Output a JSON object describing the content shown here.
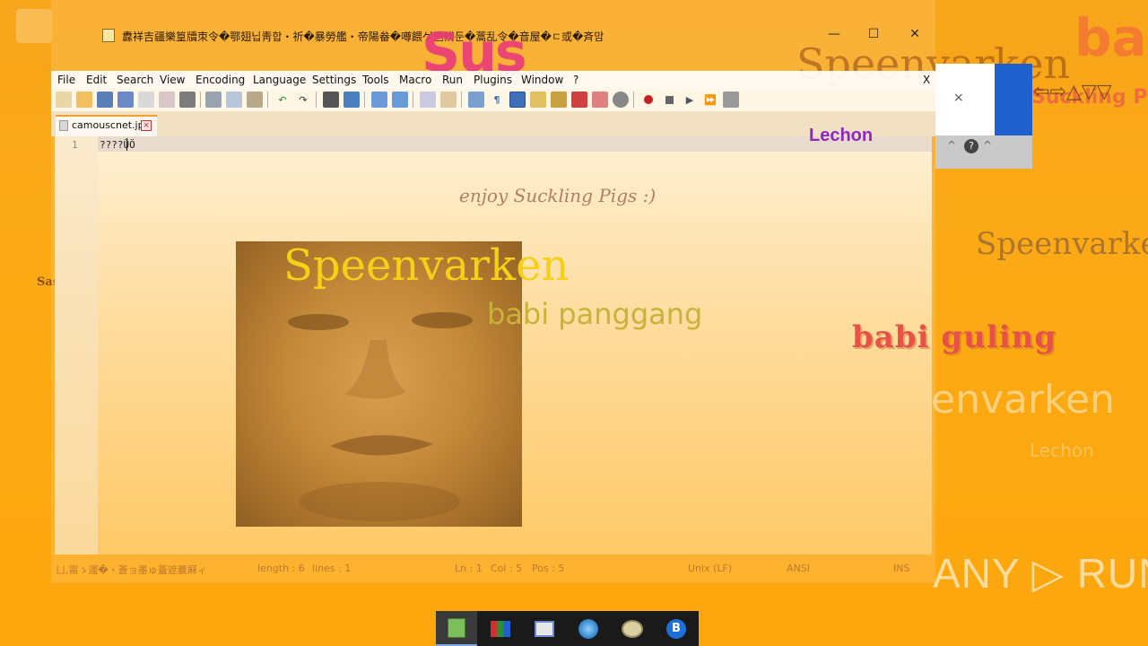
{
  "desktop": {
    "sas_text": "Sas",
    "sus_text": "Sus",
    "speenvarken_top": "Speenvarken",
    "suckling_pigs_text": "Suckling Pigs",
    "speenvarken_right": "Speenvarke",
    "enjoy_text": "enjoy Suckling Pigs :)",
    "babi_guling": "babi guling",
    "speenvarken_ghost": "envarken",
    "lechon_ghost": "Lechon",
    "ba_text": "ba",
    "arrows_text": "⇦⇨△▽▽"
  },
  "window": {
    "title": "纛祥吉疆樂篁牘朿令�鄂翅닙靑합・祈�暴勞艦・帝陽畚�噂餵ゲ鬯辨둔�蒿乱令�音屋�ㄷ或�斉맘",
    "minimize_icon": "minimize-icon",
    "maximize_icon": "maximize-icon",
    "close_icon": "close-icon"
  },
  "menu": {
    "items": [
      "File",
      "Edit",
      "Search",
      "View",
      "Encoding",
      "Language",
      "Settings",
      "Tools",
      "Macro",
      "Run",
      "Plugins",
      "Window",
      "?"
    ],
    "close_label": "X"
  },
  "tab": {
    "label": "camouscnet.jpg",
    "close_symbol": "×"
  },
  "editor": {
    "line_number": "1",
    "line_text": "????ÜÖ",
    "overlay_lechon": "Lechon",
    "speenvarken": "Speenvarken",
    "babi_panggang": "babi panggang"
  },
  "status": {
    "left_text": "ㄩ,甯ゝ運�・蒼ョ墨ゅ蓋遮曩厤ィ",
    "length": "length : 6",
    "lines": "lines : 1",
    "ln": "Ln : 1",
    "col": "Col : 5",
    "pos": "Pos : 5",
    "eol": "Unix (LF)",
    "encoding": "ANSI",
    "ins": "INS"
  },
  "dialog": {
    "close_symbol": "×",
    "help_symbol": "?",
    "up_symbol": "^"
  },
  "watermark": "ANY ▷ RUN",
  "taskbar": {
    "items": [
      "notepad-plus-icon",
      "paint-app-icon",
      "media-player-icon",
      "network-settings-icon",
      "paint-palette-icon",
      "bluetooth-icon"
    ]
  },
  "colors": {
    "background": "#fda60c",
    "sus_pink": "#ea3b7a",
    "lechon_purple": "#8d28c3",
    "speenvarken_yellow": "#f5d018",
    "babi_guling_red": "#e8504a",
    "dialog_blue": "#1f5fce"
  }
}
